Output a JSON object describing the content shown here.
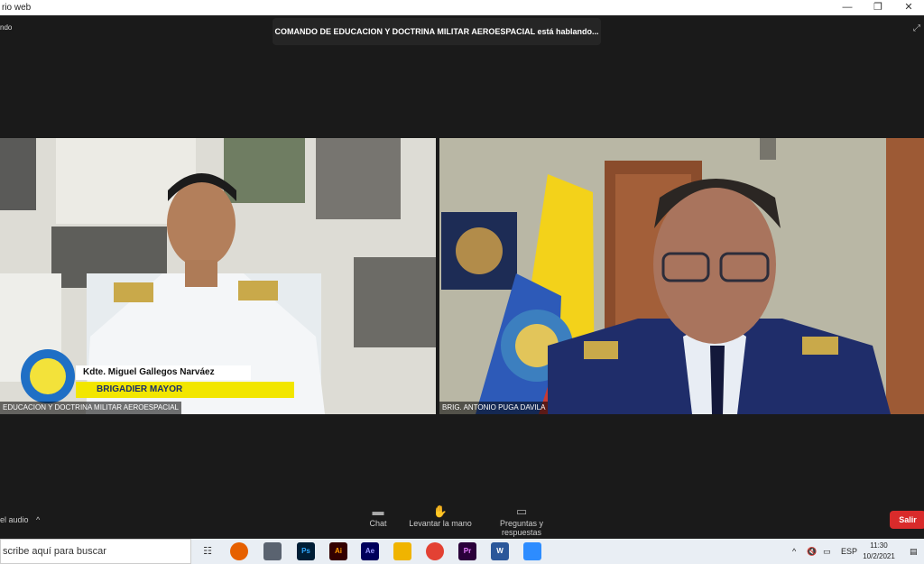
{
  "window": {
    "title": "rio web",
    "minimize": "—",
    "restore": "❐",
    "close": "✕"
  },
  "meeting": {
    "top_left_label": "ndo",
    "speaking_banner": "COMANDO DE EDUCACION Y DOCTRINA MILITAR AEROESPACIAL está hablando...",
    "expand_icon": "⤢"
  },
  "videos": [
    {
      "participant_name": "EDUCACION Y DOCTRINA MILITAR AEROESPACIAL",
      "overlay_name": "Kdte. Miguel Gallegos Narváez",
      "overlay_rank": "BRIGADIER MAYOR"
    },
    {
      "participant_name": "BRIG. ANTONIO PUGA DAVILA"
    }
  ],
  "toolbar": {
    "audio_label": "el audio",
    "audio_caret": "^",
    "chat_label": "Chat",
    "raise_hand_label": "Levantar la mano",
    "qa_label": "Preguntas y respuestas",
    "leave_label": "Salir"
  },
  "taskbar": {
    "search_placeholder": "scribe aquí para buscar",
    "apps": [
      "Ps",
      "Ai",
      "Ae",
      "Pr",
      "W"
    ],
    "tray_language": "ESP",
    "time": "11:30",
    "date": "10/2/2021"
  },
  "colors": {
    "leave": "#d92b2b",
    "banner_yellow": "#f2e600",
    "flag_yellow": "#f3d21a"
  }
}
